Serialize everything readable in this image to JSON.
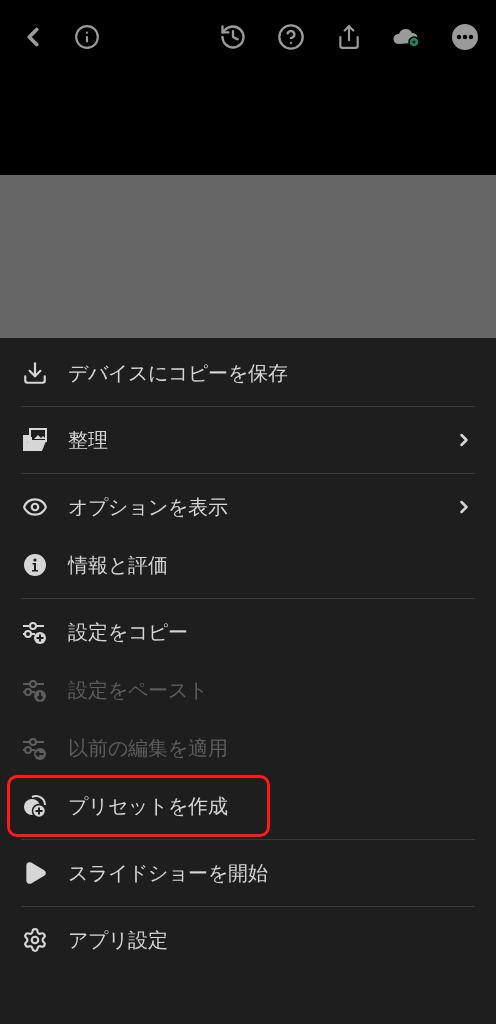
{
  "menu": {
    "items": [
      {
        "kind": "download",
        "label": "デバイスにコピーを保存",
        "submenu": false,
        "disabled": false,
        "highlighted": false,
        "divider_after": true
      },
      {
        "kind": "folder",
        "label": "整理",
        "submenu": true,
        "disabled": false,
        "highlighted": false,
        "divider_after": true
      },
      {
        "kind": "eye",
        "label": "オプションを表示",
        "submenu": true,
        "disabled": false,
        "highlighted": false,
        "divider_after": false
      },
      {
        "kind": "info",
        "label": "情報と評価",
        "submenu": false,
        "disabled": false,
        "highlighted": false,
        "divider_after": true
      },
      {
        "kind": "copy-settings",
        "label": "設定をコピー",
        "submenu": false,
        "disabled": false,
        "highlighted": false,
        "divider_after": false
      },
      {
        "kind": "paste-settings",
        "label": "設定をペースト",
        "submenu": false,
        "disabled": true,
        "highlighted": false,
        "divider_after": false
      },
      {
        "kind": "previous-settings",
        "label": "以前の編集を適用",
        "submenu": false,
        "disabled": true,
        "highlighted": false,
        "divider_after": false
      },
      {
        "kind": "preset",
        "label": "プリセットを作成",
        "submenu": false,
        "disabled": false,
        "highlighted": true,
        "divider_after": true
      },
      {
        "kind": "play",
        "label": "スライドショーを開始",
        "submenu": false,
        "disabled": false,
        "highlighted": false,
        "divider_after": true
      },
      {
        "kind": "gear",
        "label": "アプリ設定",
        "submenu": false,
        "disabled": false,
        "highlighted": false,
        "divider_after": false
      }
    ]
  }
}
